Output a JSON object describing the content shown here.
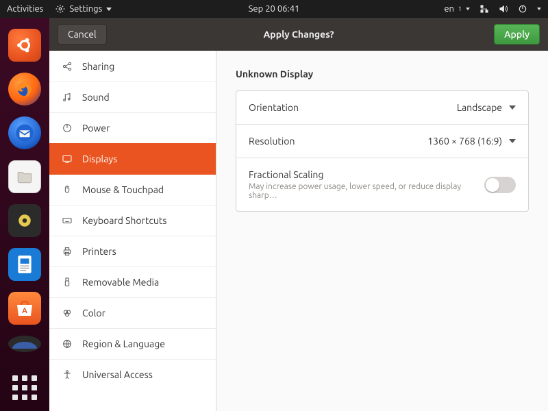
{
  "toppanel": {
    "activities": "Activities",
    "appmenu": "Settings",
    "clock": "Sep 20  06:41",
    "input_source": "en"
  },
  "dock": {
    "items": [
      "ubuntu",
      "firefox",
      "thunderbird",
      "files",
      "rhythmbox",
      "libreoffice-writer",
      "software",
      "help"
    ]
  },
  "headerbar": {
    "cancel": "Cancel",
    "title": "Apply Changes?",
    "apply": "Apply"
  },
  "sidebar": {
    "items": [
      {
        "id": "sharing",
        "label": "Sharing"
      },
      {
        "id": "sound",
        "label": "Sound"
      },
      {
        "id": "power",
        "label": "Power"
      },
      {
        "id": "displays",
        "label": "Displays"
      },
      {
        "id": "mouse",
        "label": "Mouse & Touchpad"
      },
      {
        "id": "keyboard",
        "label": "Keyboard Shortcuts"
      },
      {
        "id": "printers",
        "label": "Printers"
      },
      {
        "id": "removable",
        "label": "Removable Media"
      },
      {
        "id": "color",
        "label": "Color"
      },
      {
        "id": "region",
        "label": "Region & Language"
      },
      {
        "id": "access",
        "label": "Universal Access"
      }
    ],
    "active": "displays"
  },
  "content": {
    "section_title": "Unknown Display",
    "orientation": {
      "label": "Orientation",
      "value": "Landscape"
    },
    "resolution": {
      "label": "Resolution",
      "value": "1360 × 768 (16:9)"
    },
    "fractional": {
      "label": "Fractional Scaling",
      "sub": "May increase power usage, lower speed, or reduce display sharp…",
      "on": false
    }
  }
}
